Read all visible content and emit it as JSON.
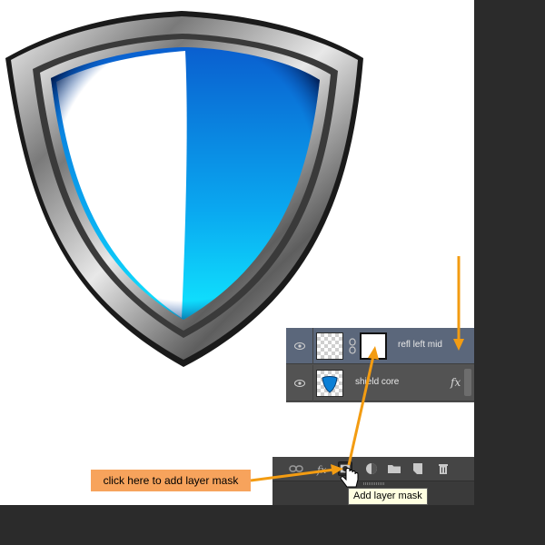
{
  "layers_panel": {
    "layers": [
      {
        "name": "refl left mid",
        "selected": true,
        "has_mask": true
      },
      {
        "name": "shield core",
        "selected": false,
        "has_fx": true,
        "fx_label": "fx"
      }
    ]
  },
  "toolbar": {
    "buttons": [
      {
        "icon": "link-icon"
      },
      {
        "icon": "fx-icon"
      },
      {
        "icon": "add-layer-mask-icon",
        "active": true
      },
      {
        "icon": "adjustment-layer-icon"
      },
      {
        "icon": "folder-icon"
      },
      {
        "icon": "new-layer-icon"
      },
      {
        "icon": "trash-icon"
      }
    ],
    "tooltip": "Add layer mask"
  },
  "annotation": {
    "callout_text": "click here to add layer mask",
    "arrow_color": "#f39c12"
  },
  "colors": {
    "selected_row": "#5b677b",
    "callout_bg": "#f7a35c",
    "tooltip_bg": "#ffffe1"
  }
}
